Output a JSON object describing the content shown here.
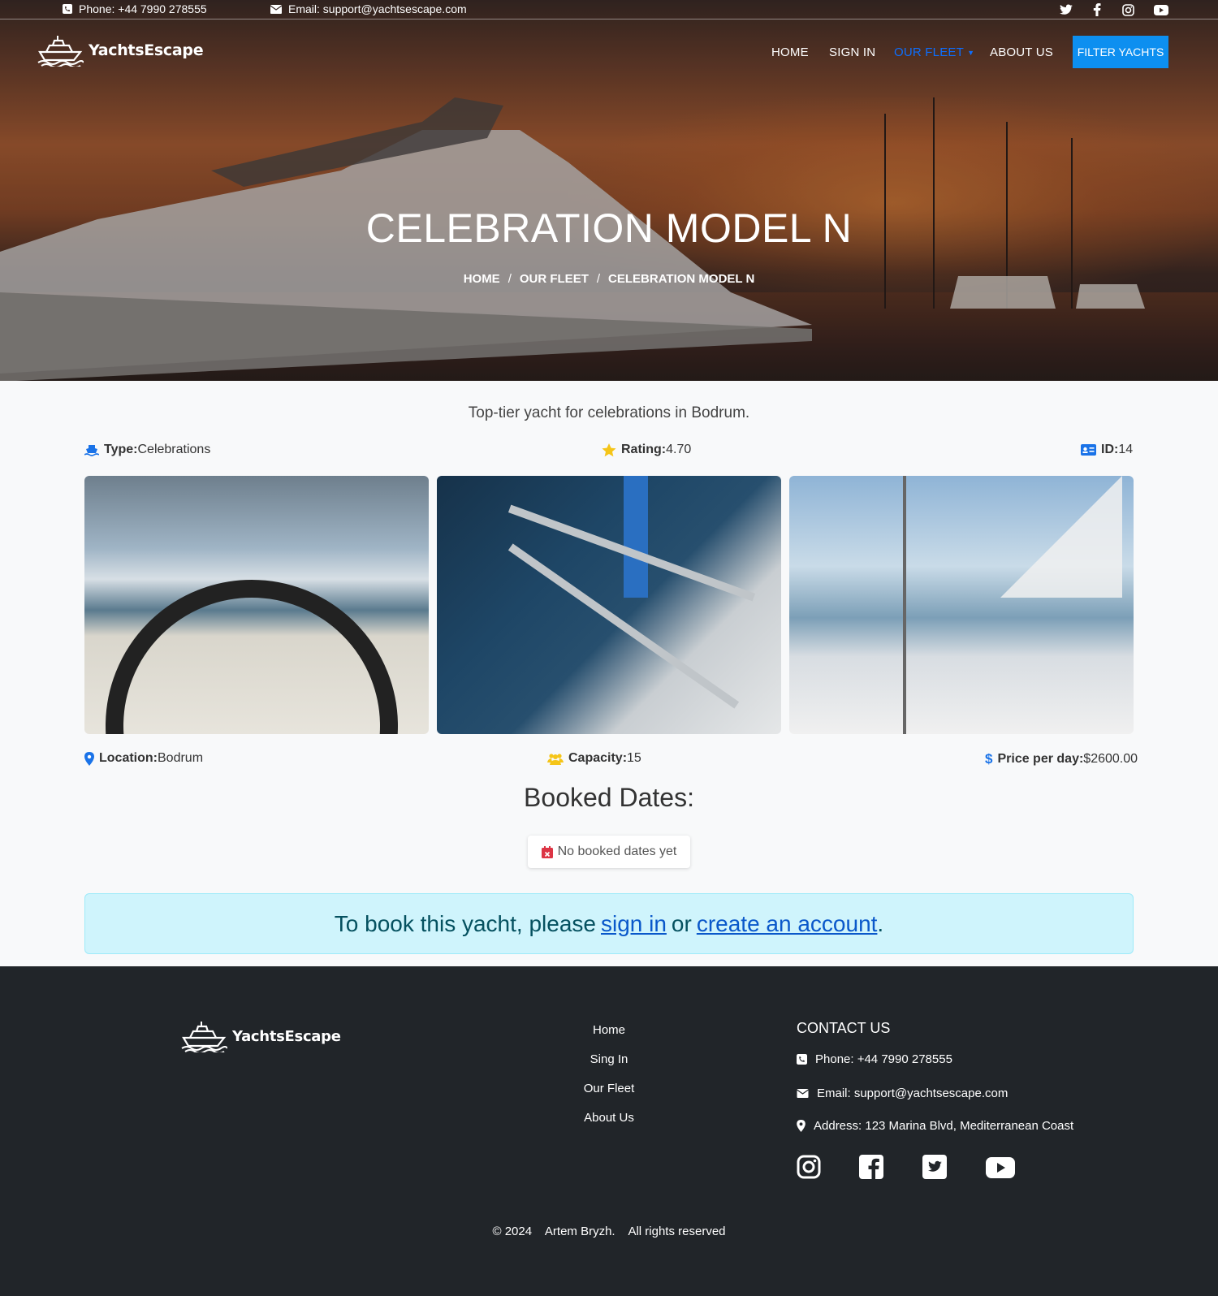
{
  "topbar": {
    "phone": "Phone: +44 7990 278555",
    "email": "Email: support@yachtsescape.com",
    "social_icons": [
      "twitter-icon",
      "facebook-icon",
      "instagram-icon",
      "youtube-icon"
    ]
  },
  "brand": {
    "name": "YachtsEscape"
  },
  "nav": {
    "items": [
      {
        "label": "HOME"
      },
      {
        "label": "SIGN IN"
      },
      {
        "label": "OUR FLEET"
      },
      {
        "label": "ABOUT US"
      }
    ],
    "cta_label": "FILTER YACHTS"
  },
  "hero": {
    "title": "CELEBRATION MODEL N",
    "breadcrumb": [
      "HOME",
      "OUR FLEET",
      "CELEBRATION MODEL N"
    ],
    "breadcrumb_sep": "/"
  },
  "yacht": {
    "description": "Top-tier yacht for celebrations in Bodrum.",
    "type_label": "Type:",
    "type_value": "Celebrations",
    "rating_label": "Rating:",
    "rating_value": "4.70",
    "id_label": "ID:",
    "id_value": "14",
    "location_label": "Location:",
    "location_value": "Bodrum",
    "capacity_label": "Capacity:",
    "capacity_value": "15",
    "price_label": "Price per day:",
    "price_value": "$2600.00"
  },
  "booking": {
    "title": "Booked Dates:",
    "empty": "No booked dates yet",
    "alert_prefix": "To book this yacht, please",
    "signin_link": "sign in",
    "alert_or": "or",
    "create_link": "create an account",
    "alert_suffix": "."
  },
  "footer": {
    "links": [
      "Home",
      "Sing In",
      "Our Fleet",
      "About Us"
    ],
    "contact_title": "CONTACT US",
    "phone": "Phone: +44 7990 278555",
    "email": "Email: support@yachtsescape.com",
    "address": "Address: 123 Marina Blvd, Mediterranean Coast",
    "social_icons": [
      "instagram-icon",
      "facebook-icon",
      "twitter-icon",
      "youtube-icon"
    ],
    "copyright_year": "© 2024",
    "copyright_name": "Artem Bryzh.",
    "copyright_rights": "All rights reserved"
  },
  "colors": {
    "accent": "#0d8ff0",
    "link": "#0a58ca",
    "footer_bg": "#212529",
    "alert_bg": "#cff4fc",
    "icon_blue": "#0d6efd",
    "icon_gold": "#f5c518"
  }
}
